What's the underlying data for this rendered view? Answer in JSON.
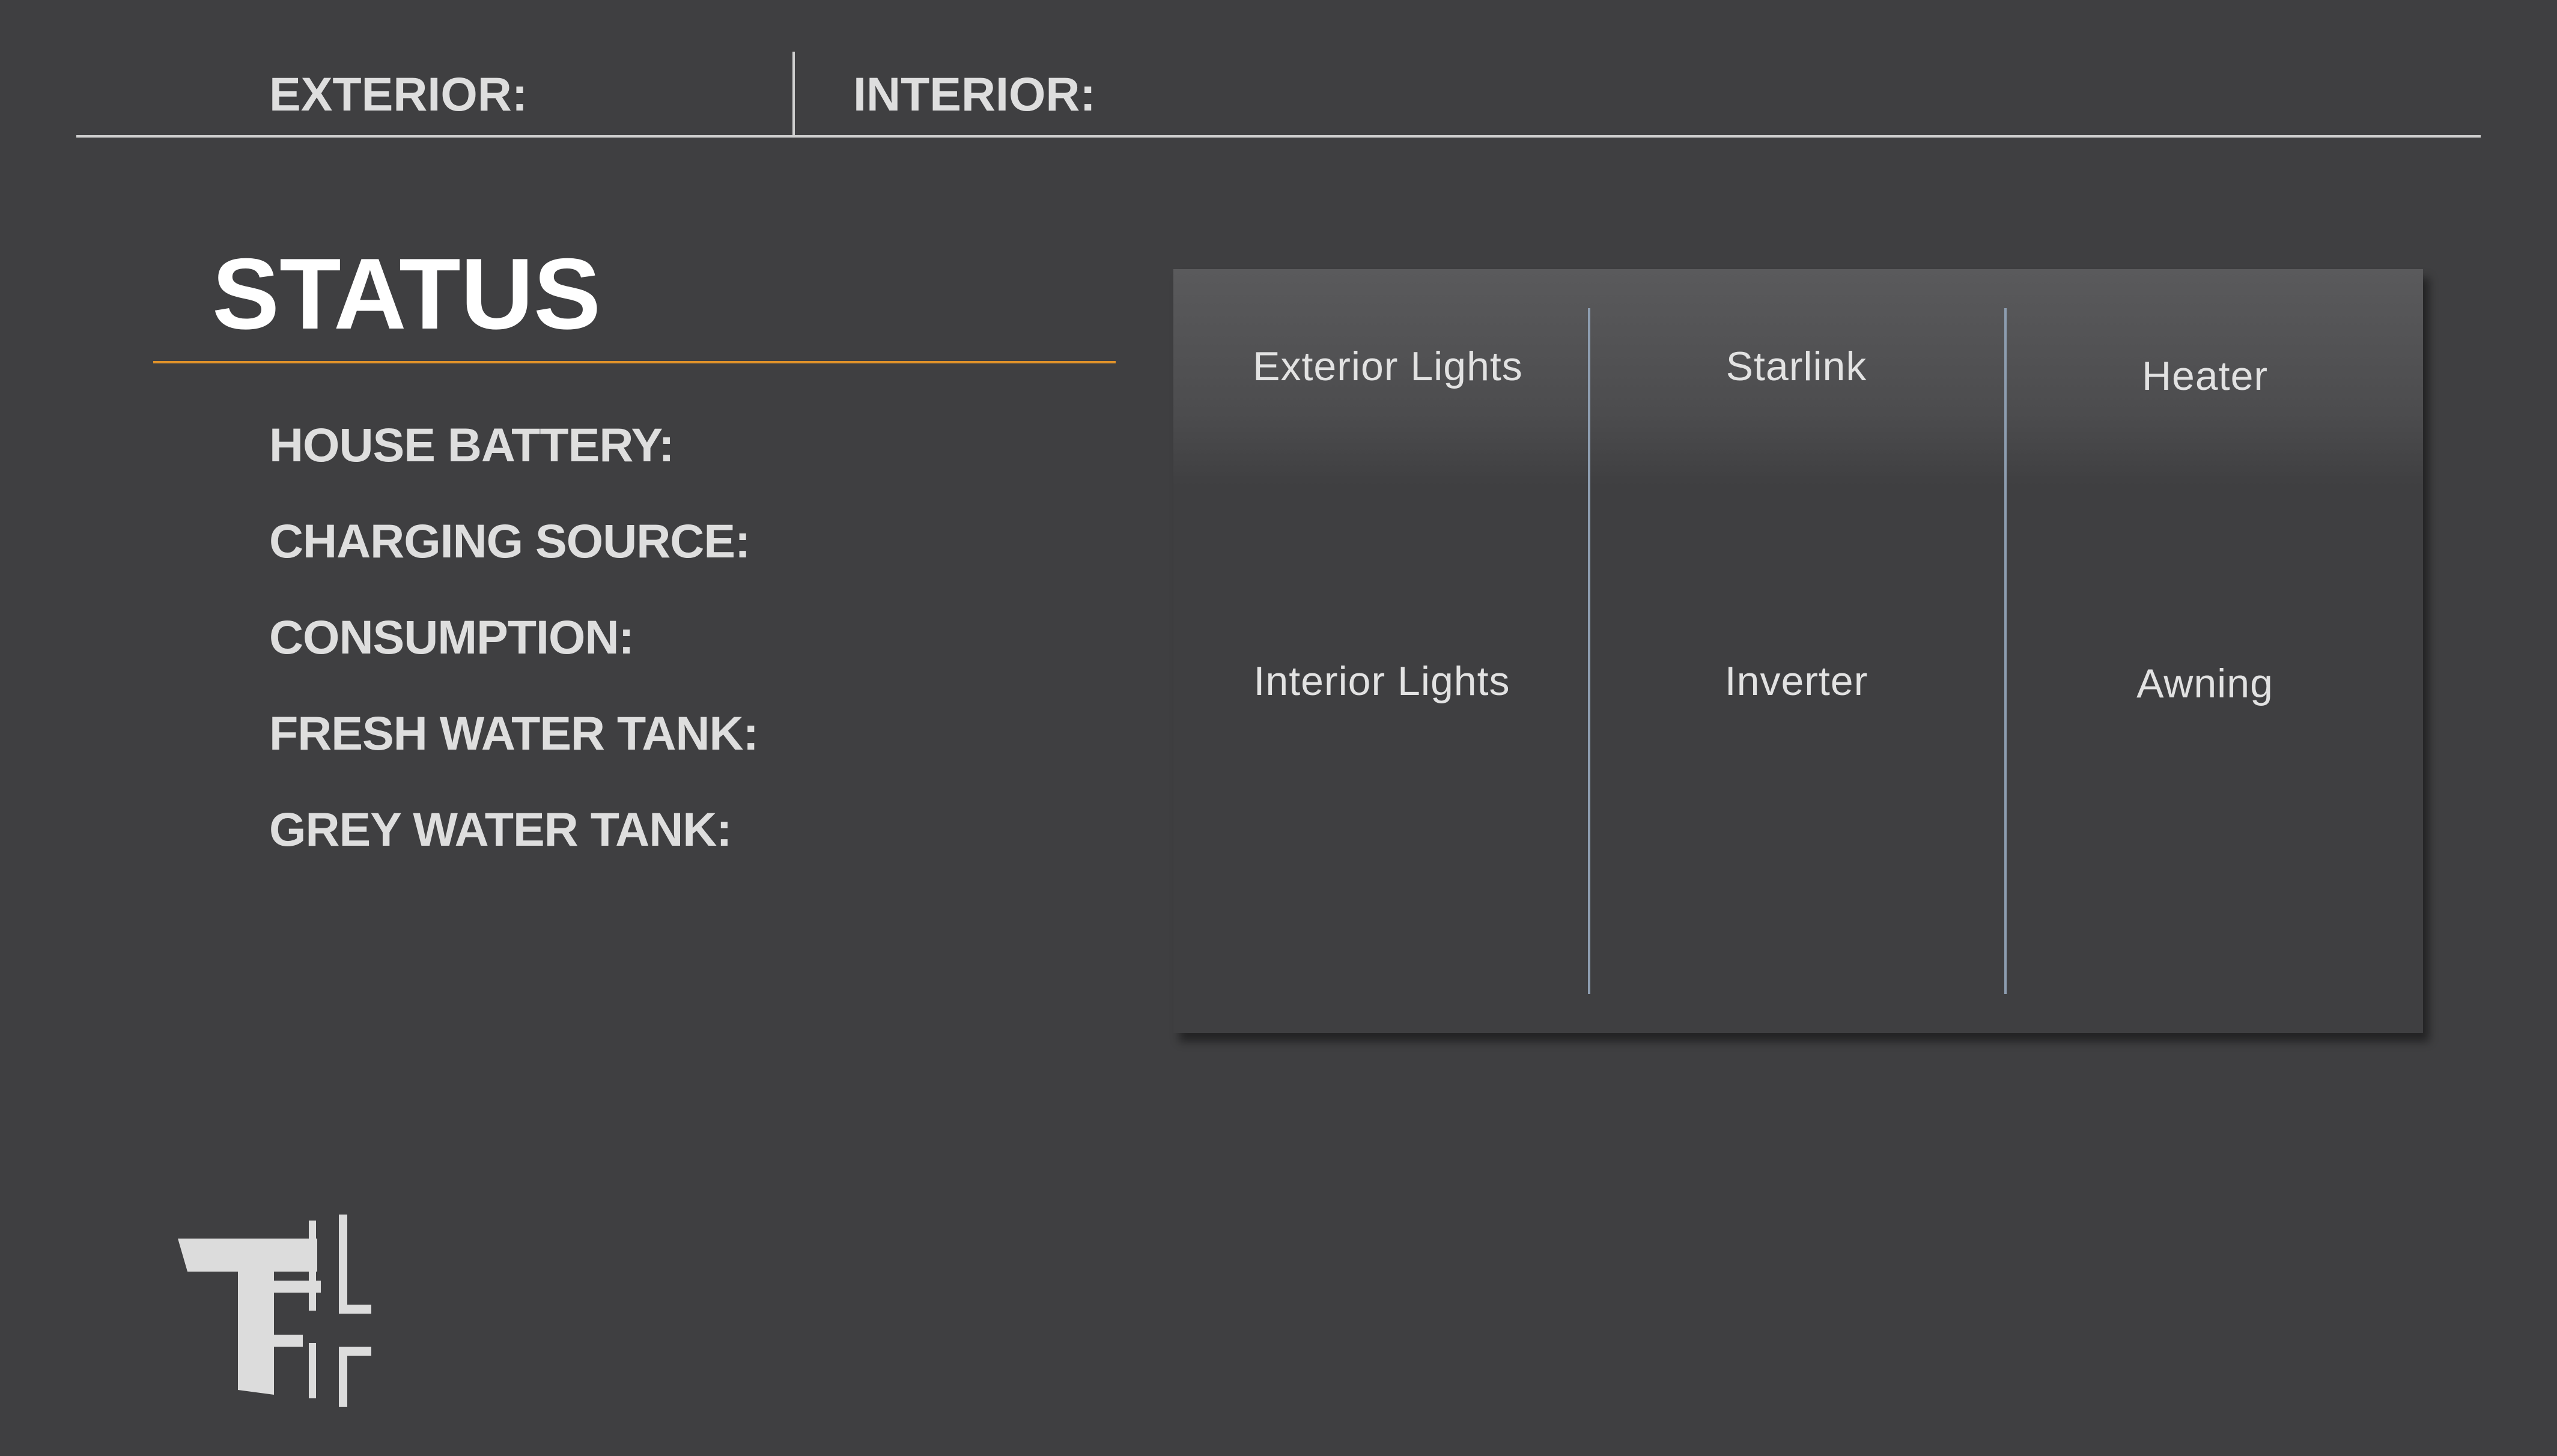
{
  "header": {
    "exterior_label": "EXTERIOR:",
    "interior_label": "INTERIOR:"
  },
  "status": {
    "title": "STATUS",
    "items": [
      {
        "label": "HOUSE BATTERY:"
      },
      {
        "label": "CHARGING SOURCE:"
      },
      {
        "label": "CONSUMPTION:"
      },
      {
        "label": "FRESH WATER TANK:"
      },
      {
        "label": "GREY WATER TANK:"
      }
    ]
  },
  "controls": {
    "items": [
      {
        "label": "Exterior Lights"
      },
      {
        "label": "Starlink"
      },
      {
        "label": "Heater"
      },
      {
        "label": "Interior Lights"
      },
      {
        "label": "Inverter"
      },
      {
        "label": "Awning"
      }
    ]
  },
  "logo": {
    "name": "brand-logo-icon"
  },
  "colors": {
    "background": "#3f3f41",
    "accent": "#e0922a",
    "divider": "#8d9db0",
    "text": "#dedede"
  }
}
